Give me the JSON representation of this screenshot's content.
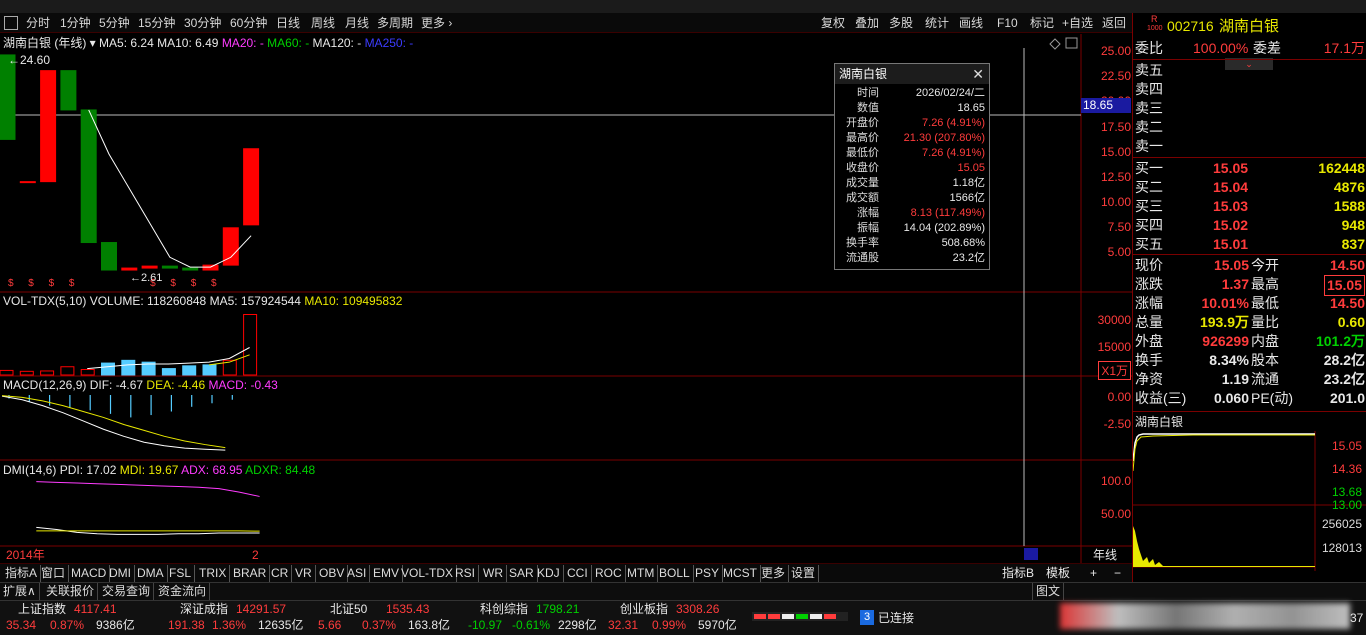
{
  "period_bar": {
    "items": [
      "分时",
      "1分钟",
      "5分钟",
      "15分钟",
      "30分钟",
      "60分钟",
      "日线",
      "周线",
      "月线",
      "多周期",
      "更多"
    ],
    "selected": "年线",
    "tools": [
      "复权",
      "叠加",
      "多股",
      "统计",
      "画线",
      "F10",
      "标记",
      "+自选",
      "返回"
    ]
  },
  "chart_header": {
    "name": "湖南白银 (年线)",
    "ma5": "MA5: 6.24",
    "ma10": "MA10: 6.49",
    "ma20": "MA20: -",
    "ma60": "MA60: -",
    "ma120": "MA120: -",
    "ma250": "MA250: -",
    "high_label": "24.60",
    "low_label": "2.61",
    "crosshair_value": "18.65"
  },
  "price_axis": [
    "25.00",
    "22.50",
    "20.00",
    "17.50",
    "15.00",
    "12.50",
    "10.00",
    "7.50",
    "5.00"
  ],
  "vol_header": {
    "name": "VOL-TDX(5,10)",
    "volume": "VOLUME: 118260848",
    "ma5": "MA5: 157924544",
    "ma10": "MA10: 109495832"
  },
  "vol_axis": [
    "30000",
    "15000"
  ],
  "vol_unit": "X1万",
  "macd_header": {
    "name": "MACD(12,26,9)",
    "dif": "DIF: -4.67",
    "dea": "DEA: -4.46",
    "macd": "MACD: -0.43"
  },
  "macd_axis": [
    "0.00",
    "-2.50"
  ],
  "dmi_header": {
    "name": "DMI(14,6)",
    "pdi": "PDI: 17.02",
    "mdi": "MDI: 19.67",
    "adx": "ADX: 68.95",
    "adxr": "ADXR: 84.48"
  },
  "dmi_axis": [
    "100.0",
    "50.00"
  ],
  "x_axis": {
    "start": "2014年",
    "mark": "2",
    "end_label": "年线"
  },
  "chart_data": {
    "type": "candlestick",
    "candles": [
      {
        "open": 24.6,
        "close": 16.0
      },
      {
        "open": 11.6,
        "close": 11.7
      },
      {
        "open": 11.7,
        "close": 23.0
      },
      {
        "open": 23.0,
        "close": 19.0
      },
      {
        "open": 19.0,
        "close": 5.5
      },
      {
        "open": 5.5,
        "close": 2.7
      },
      {
        "open": 2.7,
        "close": 2.9
      },
      {
        "open": 2.9,
        "close": 3.1
      },
      {
        "open": 3.1,
        "close": 2.9
      },
      {
        "open": 2.9,
        "close": 2.7
      },
      {
        "open": 2.7,
        "close": 3.2
      },
      {
        "open": 3.2,
        "close": 7.0
      },
      {
        "open": 7.3,
        "close": 15.05
      }
    ],
    "ma5_line": [
      null,
      null,
      null,
      null,
      19.0,
      14.5,
      11.0,
      7.5,
      4.0,
      3.0,
      3.0,
      4.0,
      6.2
    ],
    "volume": [
      2500,
      2000,
      2200,
      4500,
      3000,
      6500,
      8000,
      7000,
      3500,
      5000,
      5500,
      8000,
      33000
    ],
    "volume_colors": [
      "red",
      "red",
      "red",
      "red",
      "red",
      "cyan",
      "cyan",
      "cyan",
      "cyan",
      "cyan",
      "cyan",
      "red",
      "red"
    ],
    "vol_ma": [
      null,
      null,
      null,
      null,
      3500,
      4500,
      5500,
      6000,
      6000,
      6500,
      7000,
      9000,
      15000
    ],
    "vol_ma10": [
      null,
      null,
      null,
      null,
      null,
      null,
      null,
      null,
      null,
      null,
      5500,
      7000,
      11000
    ],
    "macd_bars": [
      -0.3,
      -0.6,
      -0.9,
      -1.1,
      -1.3,
      -1.6,
      -1.9,
      -1.7,
      -1.4,
      -1.0,
      -0.7,
      -0.4
    ],
    "dif": [
      -0.1,
      -0.4,
      -0.9,
      -1.5,
      -2.2,
      -2.9,
      -3.5,
      -4.0,
      -4.3,
      -4.5,
      -4.6,
      -4.67
    ],
    "dea": [
      -0.05,
      -0.2,
      -0.5,
      -0.9,
      -1.4,
      -1.9,
      -2.5,
      -3.0,
      -3.5,
      -3.9,
      -4.2,
      -4.46
    ],
    "pdi": [
      25,
      22,
      18,
      16,
      15,
      15,
      15,
      16,
      16,
      17,
      17,
      17.02
    ],
    "mdi": [
      20,
      20,
      20,
      20,
      20,
      20,
      20,
      20,
      20,
      20,
      20,
      19.67
    ],
    "adx": [
      90,
      89,
      88,
      87,
      86,
      85,
      84,
      83,
      82,
      80,
      75,
      68.95
    ],
    "adxr": [
      null,
      null,
      null,
      null,
      null,
      null,
      null,
      null,
      null,
      null,
      null,
      84.48
    ]
  },
  "tooltip": {
    "title": "湖南白银",
    "rows": [
      {
        "k": "时间",
        "v": "2026/02/24/二",
        "c": "wht"
      },
      {
        "k": "数值",
        "v": "18.65",
        "c": "wht"
      },
      {
        "k": "开盘价",
        "v": "7.26 (4.91%)",
        "c": "red"
      },
      {
        "k": "最高价",
        "v": "21.30 (207.80%)",
        "c": "red"
      },
      {
        "k": "最低价",
        "v": "7.26 (4.91%)",
        "c": "red"
      },
      {
        "k": "收盘价",
        "v": "15.05",
        "c": "red"
      },
      {
        "k": "成交量",
        "v": "1.18亿",
        "c": "wht"
      },
      {
        "k": "成交额",
        "v": "1566亿",
        "c": "wht"
      },
      {
        "k": "涨幅",
        "v": "8.13 (117.49%)",
        "c": "red"
      },
      {
        "k": "振幅",
        "v": "14.04 (202.89%)",
        "c": "wht"
      },
      {
        "k": "换手率",
        "v": "508.68%",
        "c": "wht"
      },
      {
        "k": "流通股",
        "v": "23.2亿",
        "c": "wht"
      }
    ]
  },
  "quote": {
    "code": "002716",
    "name": "湖南白银",
    "wei_bi_label": "委比",
    "wei_bi": "100.00%",
    "wei_cha_label": "委差",
    "wei_cha": "17.1万",
    "sell": [
      "卖五",
      "卖四",
      "卖三",
      "卖二",
      "卖一"
    ],
    "buy": [
      {
        "label": "买一",
        "price": "15.05",
        "vol": "162448"
      },
      {
        "label": "买二",
        "price": "15.04",
        "vol": "4876"
      },
      {
        "label": "买三",
        "price": "15.03",
        "vol": "1588"
      },
      {
        "label": "买四",
        "price": "15.02",
        "vol": "948"
      },
      {
        "label": "买五",
        "price": "15.01",
        "vol": "837"
      }
    ],
    "stats": [
      {
        "l1": "现价",
        "v1": "15.05",
        "c1": "red",
        "l2": "今开",
        "v2": "14.50",
        "c2": "red"
      },
      {
        "l1": "涨跌",
        "v1": "1.37",
        "c1": "red",
        "l2": "最高",
        "v2": "15.05",
        "c2": "red"
      },
      {
        "l1": "涨幅",
        "v1": "10.01%",
        "c1": "red",
        "l2": "最低",
        "v2": "14.50",
        "c2": "red"
      },
      {
        "l1": "总量",
        "v1": "193.9万",
        "c1": "yel",
        "l2": "量比",
        "v2": "0.60",
        "c2": "yel"
      },
      {
        "l1": "外盘",
        "v1": "926299",
        "c1": "red",
        "l2": "内盘",
        "v2": "101.2万",
        "c2": "grn"
      },
      {
        "l1": "换手",
        "v1": "8.34%",
        "c1": "wht",
        "l2": "股本",
        "v2": "28.2亿",
        "c2": "wht"
      },
      {
        "l1": "净资",
        "v1": "1.19",
        "c1": "wht",
        "l2": "流通",
        "v2": "23.2亿",
        "c2": "wht"
      },
      {
        "l1": "收益(三)",
        "v1": "0.060",
        "c1": "wht",
        "l2": "PE(动)",
        "v2": "201.0",
        "c2": "wht"
      }
    ],
    "mini_title": "湖南白银",
    "mini_axis": [
      "15.05",
      "14.36",
      "13.68",
      "13.00"
    ],
    "mini_vol_axis": [
      "256025",
      "128013"
    ]
  },
  "indicators": [
    "指标A",
    "窗口",
    "MACD",
    "DMI",
    "DMA",
    "FSL",
    "TRIX",
    "BRAR",
    "CR",
    "VR",
    "OBV",
    "ASI",
    "EMV",
    "VOL-TDX",
    "RSI",
    "WR",
    "SAR",
    "KDJ",
    "CCI",
    "ROC",
    "MTM",
    "BOLL",
    "PSY",
    "MCST",
    "更多",
    "设置"
  ],
  "indicator_right": [
    "指标B",
    "模板",
    "+",
    "−"
  ],
  "ext_tabs": [
    "扩展∧",
    "关联报价",
    "交易查询",
    "资金流向"
  ],
  "ext_right": "图文",
  "indices": [
    {
      "name": "上证指数",
      "val": "4117.41",
      "chg": "35.34",
      "pct": "0.87%",
      "amt": "9386亿"
    },
    {
      "name": "深证成指",
      "val": "14291.57",
      "chg": "191.38",
      "pct": "1.36%",
      "amt": "12635亿"
    },
    {
      "name": "北证50",
      "val": "1535.43",
      "chg": "5.66",
      "pct": "0.37%",
      "amt": "163.8亿"
    },
    {
      "name": "科创综指",
      "val": "1798.21",
      "chg": "-10.97",
      "pct": "-0.61%",
      "amt": "2298亿"
    },
    {
      "name": "创业板指",
      "val": "3308.26",
      "chg": "32.31",
      "pct": "0.99%",
      "amt": "5970亿"
    }
  ],
  "conn": {
    "badge": "3",
    "text": "已连接"
  },
  "clock": "37"
}
